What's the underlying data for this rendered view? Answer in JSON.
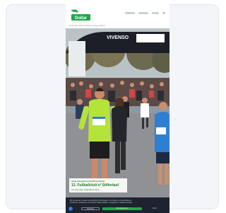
{
  "page": {
    "logo_text": "Dollar",
    "subline": "Corporate Stadt Umland Cologne Bonn",
    "banner_text": "VIVENSO"
  },
  "hero": {
    "caption_small": "www.cologne-bonn-inkl-ventures",
    "caption_title": "13. Fußballclub's* Stifterlauf",
    "caption_date": "am Sonntag, Spandauer Stra..."
  },
  "consent": {
    "line1": "Wir verwenden Cookies und ähnliche Technologien, um Inhalte zu personalisieren,",
    "line2": "Funktionen anzubieten und unseren Datenverkehr zu analysieren. Details anzeigen",
    "reject_label": "Ablehnen",
    "accept_label": "Alle akzeptieren",
    "more_label": "Mehr"
  },
  "colors": {
    "brand_green": "#1fa84a",
    "consent_bg": "#1d2430",
    "shirt_yellow": "#b4e33a",
    "shirt_blue": "#2f7fd1"
  }
}
